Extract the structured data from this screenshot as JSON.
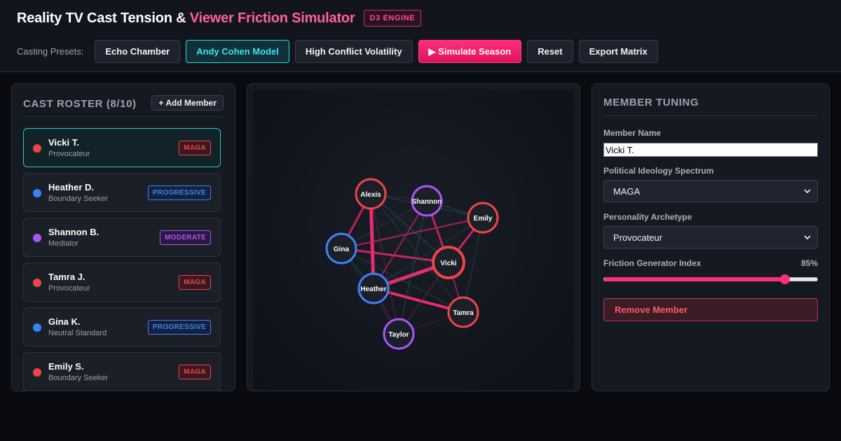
{
  "header": {
    "title_main": "Reality TV Cast Tension",
    "title_amp": "&",
    "title_accent": "Viewer Friction Simulator",
    "engine_badge": "D3 ENGINE"
  },
  "presets": {
    "label": "Casting Presets:",
    "buttons": [
      "Echo Chamber",
      "Andy Cohen Model",
      "High Conflict Volatility"
    ],
    "active": "Andy Cohen Model",
    "simulate": "▶ Simulate Season",
    "reset": "Reset",
    "export": "Export Matrix"
  },
  "roster": {
    "title": "CAST ROSTER (8/10)",
    "add_label": "+ Add Member",
    "members": [
      {
        "name": "Vicki T.",
        "role": "Provocateur",
        "tag": "MAGA",
        "selected": true
      },
      {
        "name": "Heather D.",
        "role": "Boundary Seeker",
        "tag": "PROGRESSIVE"
      },
      {
        "name": "Shannon B.",
        "role": "Mediator",
        "tag": "MODERATE"
      },
      {
        "name": "Tamra J.",
        "role": "Provocateur",
        "tag": "MAGA"
      },
      {
        "name": "Gina K.",
        "role": "Neutral Standard",
        "tag": "PROGRESSIVE"
      },
      {
        "name": "Emily S.",
        "role": "Boundary Seeker",
        "tag": "MAGA"
      }
    ]
  },
  "ideology_colors": {
    "MAGA": "#ef4444",
    "PROGRESSIVE": "#3b82f6",
    "MODERATE": "#a855f7"
  },
  "graph": {
    "nodes": [
      {
        "id": "Alexis",
        "ideology": "MAGA"
      },
      {
        "id": "Shannon",
        "ideology": "MODERATE"
      },
      {
        "id": "Emily",
        "ideology": "MAGA"
      },
      {
        "id": "Gina",
        "ideology": "PROGRESSIVE"
      },
      {
        "id": "Vicki",
        "ideology": "MAGA",
        "selected": true
      },
      {
        "id": "Heather",
        "ideology": "PROGRESSIVE"
      },
      {
        "id": "Tamra",
        "ideology": "MAGA"
      },
      {
        "id": "Taylor",
        "ideology": "MODERATE"
      }
    ]
  },
  "tuning": {
    "title": "MEMBER TUNING",
    "name_label": "Member Name",
    "name_value": "Vicki T.",
    "ideology_label": "Political Ideology Spectrum",
    "ideology_value": "MAGA",
    "archetype_label": "Personality Archetype",
    "archetype_value": "Provocateur",
    "friction_label": "Friction Generator Index",
    "friction_display": "85%",
    "friction_value": 0.85,
    "remove_label": "Remove Member"
  }
}
